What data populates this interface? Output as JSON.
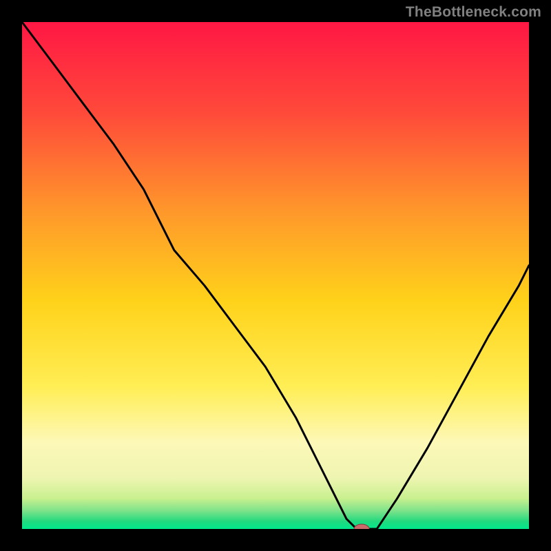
{
  "watermark": "TheBottleneck.com",
  "chart_data": {
    "type": "line",
    "title": "",
    "xlabel": "",
    "ylabel": "",
    "xlim": [
      0,
      100
    ],
    "ylim": [
      0,
      100
    ],
    "grid": false,
    "background_gradient": {
      "type": "vertical",
      "stops": [
        {
          "offset": 0.0,
          "color": "#ff1744"
        },
        {
          "offset": 0.18,
          "color": "#ff4a3a"
        },
        {
          "offset": 0.38,
          "color": "#ff9a2a"
        },
        {
          "offset": 0.55,
          "color": "#ffd21a"
        },
        {
          "offset": 0.72,
          "color": "#ffee55"
        },
        {
          "offset": 0.83,
          "color": "#fdf8b8"
        },
        {
          "offset": 0.9,
          "color": "#eef5b0"
        },
        {
          "offset": 0.94,
          "color": "#c8f08f"
        },
        {
          "offset": 0.965,
          "color": "#7ae28a"
        },
        {
          "offset": 0.985,
          "color": "#22d97e"
        },
        {
          "offset": 1.0,
          "color": "#00e88c"
        }
      ]
    },
    "series": [
      {
        "name": "bottleneck-curve",
        "color": "#000000",
        "width": 3,
        "x": [
          0,
          6,
          12,
          18,
          24,
          30,
          36,
          42,
          48,
          54,
          58,
          62,
          64,
          66,
          68,
          70,
          74,
          80,
          86,
          92,
          98,
          100
        ],
        "y": [
          100,
          92,
          84,
          76,
          67,
          55,
          48,
          40,
          32,
          22,
          14,
          6,
          2,
          0,
          0,
          0,
          6,
          16,
          27,
          38,
          48,
          52
        ]
      }
    ],
    "marker": {
      "name": "optimal-point",
      "x": 67,
      "y": 0,
      "shape": "pill",
      "fill": "#c96b6b",
      "stroke": "#7d3c3c"
    }
  }
}
